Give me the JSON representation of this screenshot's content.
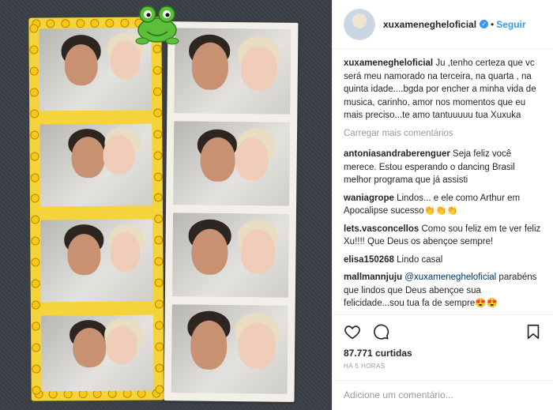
{
  "post": {
    "username": "xuxamenegheloficial",
    "separator": "•",
    "follow_label": "Seguir"
  },
  "caption": {
    "user": "xuxamenegheloficial",
    "text": "Ju ,tenho certeza que vc será meu namorado na terceira, na quarta , na quinta idade....bgda por encher a minha vida de musica, carinho, amor nos momentos que eu mais preciso...te amo tantuuuuu tua Xuxuka"
  },
  "load_more": "Carregar mais comentários",
  "comments": [
    {
      "user": "antoniasandraberenguer",
      "text": "Seja feliz você merece. Estou esperando o dancing Brasil melhor programa que já assisti"
    },
    {
      "user": "waniagrope",
      "text": "Lindos... e ele como Arthur em Apocalipse sucesso👏👏👏"
    },
    {
      "user": "lets.vasconcellos",
      "text": "Como sou feliz em te ver feliz Xu!!!! Que Deus os abençoe sempre!"
    },
    {
      "user": "elisa150268",
      "text": "Lindo casal"
    },
    {
      "user": "mallmannjuju",
      "mention": "@xuxamenegheloficial",
      "text": "parabéns que lindos que Deus abençoe sua felicidade...sou tua fa de sempre😍😍"
    }
  ],
  "likes": "87.771 curtidas",
  "timestamp": "HÁ 5 HORAS",
  "add_comment_placeholder": "Adicione um comentário..."
}
